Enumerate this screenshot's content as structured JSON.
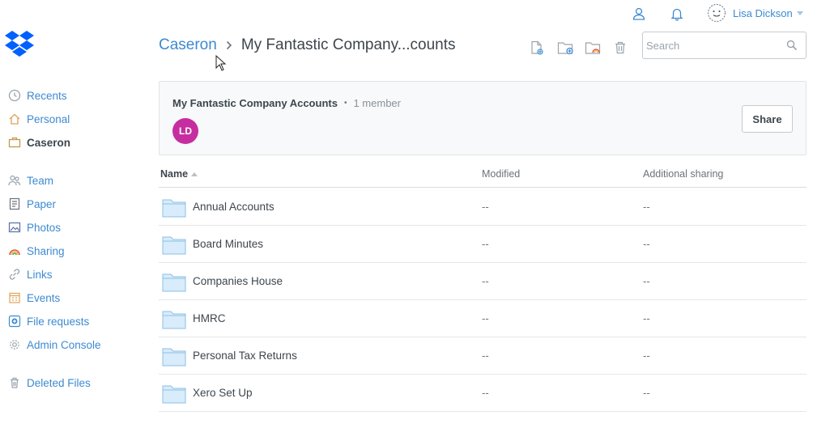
{
  "sidebar": {
    "items": [
      {
        "label": "Recents",
        "icon": "clock-icon"
      },
      {
        "label": "Personal",
        "icon": "home-icon"
      },
      {
        "label": "Caseron",
        "icon": "briefcase-icon",
        "active": true
      },
      {
        "label": "Team",
        "icon": "team-icon"
      },
      {
        "label": "Paper",
        "icon": "paper-icon"
      },
      {
        "label": "Photos",
        "icon": "photos-icon"
      },
      {
        "label": "Sharing",
        "icon": "sharing-icon"
      },
      {
        "label": "Links",
        "icon": "link-icon"
      },
      {
        "label": "Events",
        "icon": "calendar-icon"
      },
      {
        "label": "File requests",
        "icon": "file-request-icon"
      },
      {
        "label": "Admin Console",
        "icon": "gear-icon"
      },
      {
        "label": "Deleted Files",
        "icon": "trash-icon"
      }
    ]
  },
  "account": {
    "name": "Lisa Dickson"
  },
  "breadcrumb": {
    "parent": "Caseron",
    "current": "My Fantastic Company...counts"
  },
  "search": {
    "placeholder": "Search",
    "value": ""
  },
  "members_card": {
    "title": "My Fantastic Company Accounts",
    "separator": "•",
    "count": "1 member",
    "avatar_initials": "LD",
    "share_label": "Share"
  },
  "table": {
    "columns": {
      "name": "Name",
      "modified": "Modified",
      "sharing": "Additional sharing"
    },
    "rows": [
      {
        "name": "Annual Accounts",
        "modified": "--",
        "sharing": "--"
      },
      {
        "name": "Board Minutes",
        "modified": "--",
        "sharing": "--"
      },
      {
        "name": "Companies House",
        "modified": "--",
        "sharing": "--"
      },
      {
        "name": "HMRC",
        "modified": "--",
        "sharing": "--"
      },
      {
        "name": "Personal Tax Returns",
        "modified": "--",
        "sharing": "--"
      },
      {
        "name": "Xero Set Up",
        "modified": "--",
        "sharing": "--"
      }
    ]
  },
  "colors": {
    "accent": "#3d8ad1",
    "avatar": "#c62ea0",
    "brand": "#0061fe"
  }
}
